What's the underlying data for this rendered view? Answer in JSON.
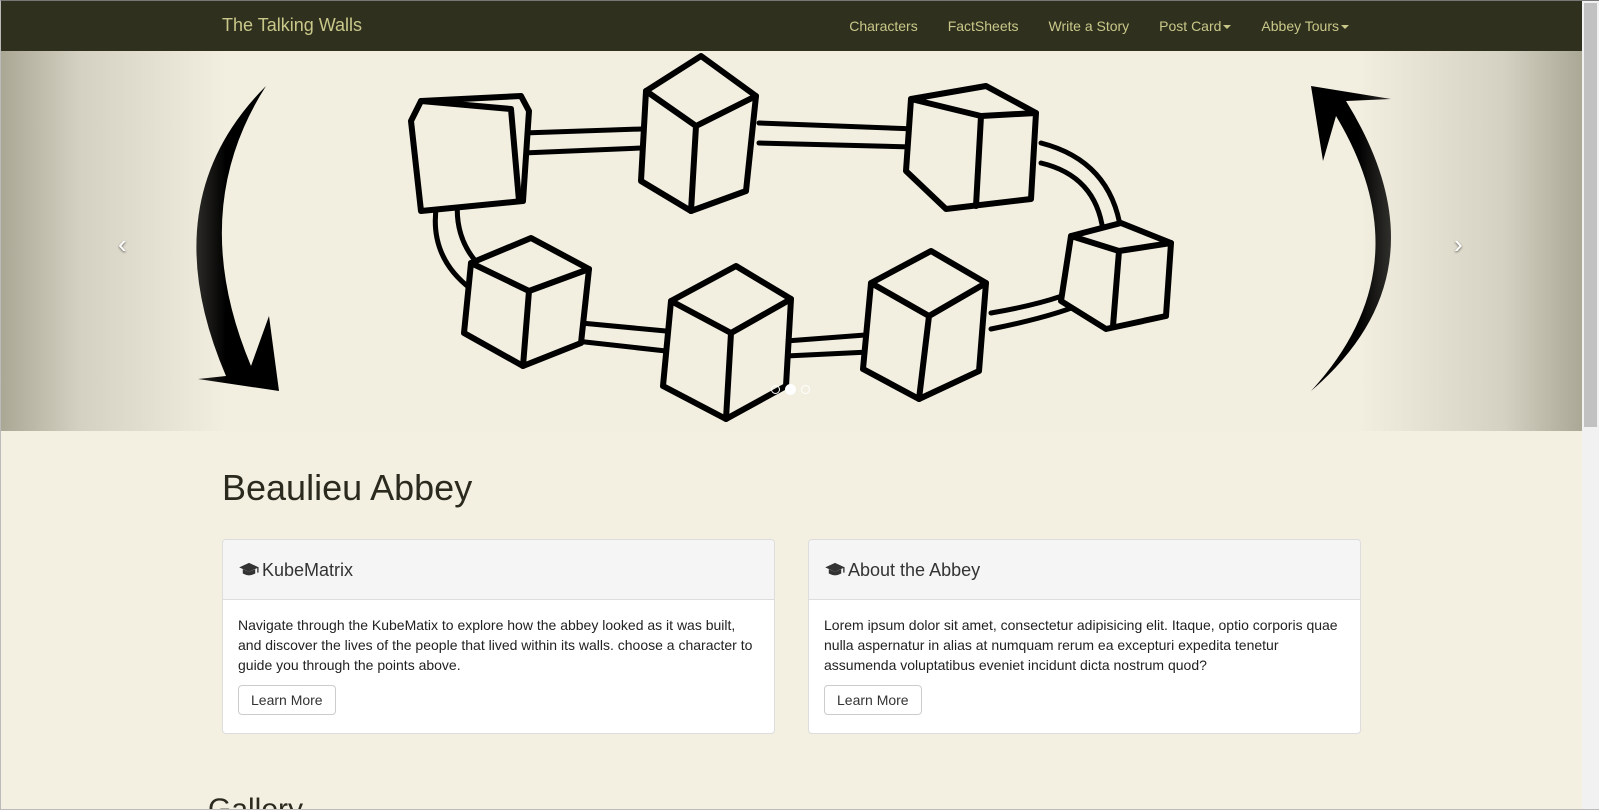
{
  "navbar": {
    "brand": "The Talking Walls",
    "items": [
      {
        "label": "Characters",
        "dropdown": false
      },
      {
        "label": "FactSheets",
        "dropdown": false
      },
      {
        "label": "Write a Story",
        "dropdown": false
      },
      {
        "label": "Post Card",
        "dropdown": true
      },
      {
        "label": "Abbey Tours",
        "dropdown": true
      }
    ]
  },
  "carousel": {
    "prev_label": "‹",
    "next_label": "›",
    "slide_count": 3,
    "active_slide": 2
  },
  "main": {
    "title": "Beaulieu Abbey",
    "panels": [
      {
        "icon": "graduation-cap-icon",
        "heading": "KubeMatrix",
        "body": "Navigate through the KubeMatix to explore how the abbey looked as it was built, and discover the lives of the people that lived within its walls. choose a character to guide you through the points above.",
        "button": "Learn More"
      },
      {
        "icon": "graduation-cap-icon",
        "heading": "About the Abbey",
        "body": "Lorem ipsum dolor sit amet, consectetur adipisicing elit. Itaque, optio corporis quae nulla aspernatur in alias at numquam rerum ea excepturi expedita tenetur assumenda voluptatibus eveniet incidunt dicta nostrum quod?",
        "button": "Learn More"
      }
    ],
    "gallery_heading": "Gallery"
  },
  "colors": {
    "navbar_bg": "#2f301d",
    "navbar_text": "#c9c88a",
    "page_bg": "#f3efe1",
    "carousel_bg": "#f2eee0"
  }
}
